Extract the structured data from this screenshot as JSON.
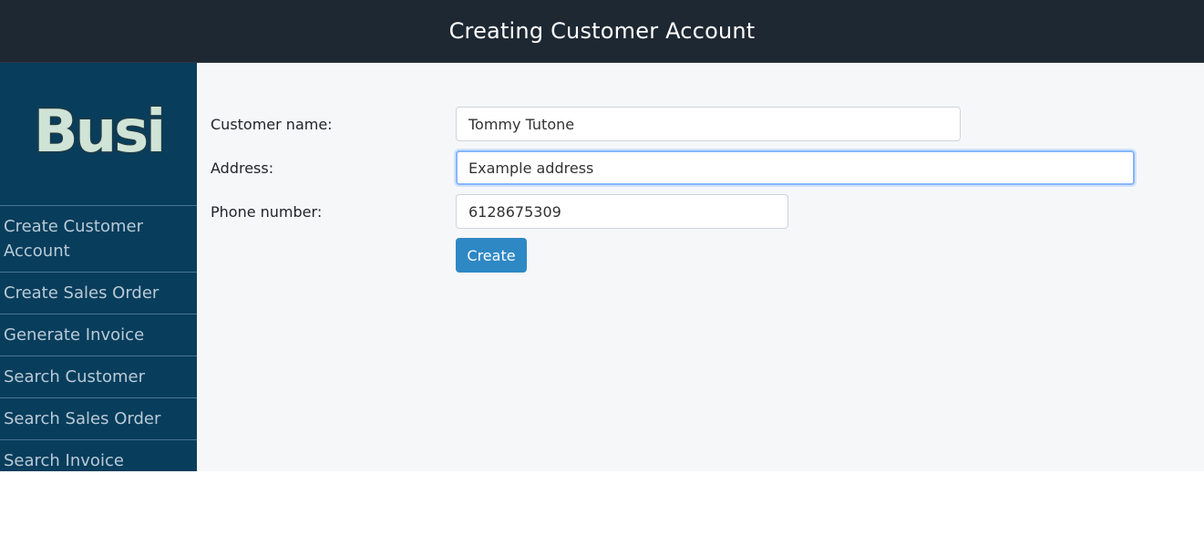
{
  "header": {
    "title": "Creating Customer Account"
  },
  "sidebar": {
    "logo_text": "Busi",
    "items": [
      {
        "label": "Create Customer Account"
      },
      {
        "label": "Create Sales Order"
      },
      {
        "label": "Generate Invoice"
      },
      {
        "label": "Search Customer"
      },
      {
        "label": "Search Sales Order"
      },
      {
        "label": "Search Invoice"
      }
    ]
  },
  "form": {
    "customer_name_label": "Customer name:",
    "customer_name_value": "Tommy Tutone",
    "address_label": "Address:",
    "address_value": "Example address",
    "phone_label": "Phone number:",
    "phone_value": "6128675309",
    "create_label": "Create"
  },
  "colors": {
    "topbar": "#1e2833",
    "sidebar": "#083d5c",
    "button": "#2e88c4",
    "main_bg": "#f5f7f9"
  }
}
